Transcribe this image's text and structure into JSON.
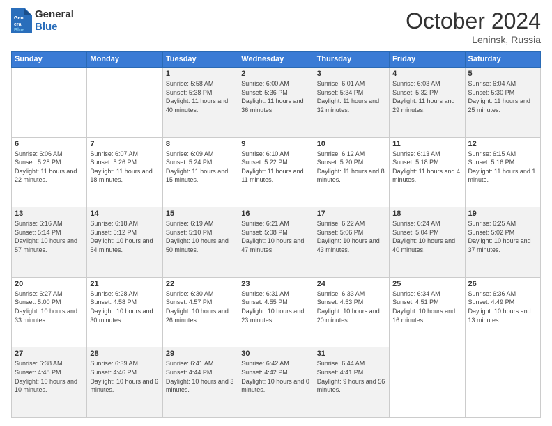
{
  "header": {
    "logo_general": "General",
    "logo_blue": "Blue",
    "month": "October 2024",
    "location": "Leninsk, Russia"
  },
  "days_of_week": [
    "Sunday",
    "Monday",
    "Tuesday",
    "Wednesday",
    "Thursday",
    "Friday",
    "Saturday"
  ],
  "weeks": [
    [
      {
        "day": "",
        "sunrise": "",
        "sunset": "",
        "daylight": "",
        "empty": true
      },
      {
        "day": "",
        "sunrise": "",
        "sunset": "",
        "daylight": "",
        "empty": true
      },
      {
        "day": "1",
        "sunrise": "Sunrise: 5:58 AM",
        "sunset": "Sunset: 5:38 PM",
        "daylight": "Daylight: 11 hours and 40 minutes.",
        "empty": false
      },
      {
        "day": "2",
        "sunrise": "Sunrise: 6:00 AM",
        "sunset": "Sunset: 5:36 PM",
        "daylight": "Daylight: 11 hours and 36 minutes.",
        "empty": false
      },
      {
        "day": "3",
        "sunrise": "Sunrise: 6:01 AM",
        "sunset": "Sunset: 5:34 PM",
        "daylight": "Daylight: 11 hours and 32 minutes.",
        "empty": false
      },
      {
        "day": "4",
        "sunrise": "Sunrise: 6:03 AM",
        "sunset": "Sunset: 5:32 PM",
        "daylight": "Daylight: 11 hours and 29 minutes.",
        "empty": false
      },
      {
        "day": "5",
        "sunrise": "Sunrise: 6:04 AM",
        "sunset": "Sunset: 5:30 PM",
        "daylight": "Daylight: 11 hours and 25 minutes.",
        "empty": false
      }
    ],
    [
      {
        "day": "6",
        "sunrise": "Sunrise: 6:06 AM",
        "sunset": "Sunset: 5:28 PM",
        "daylight": "Daylight: 11 hours and 22 minutes.",
        "empty": false
      },
      {
        "day": "7",
        "sunrise": "Sunrise: 6:07 AM",
        "sunset": "Sunset: 5:26 PM",
        "daylight": "Daylight: 11 hours and 18 minutes.",
        "empty": false
      },
      {
        "day": "8",
        "sunrise": "Sunrise: 6:09 AM",
        "sunset": "Sunset: 5:24 PM",
        "daylight": "Daylight: 11 hours and 15 minutes.",
        "empty": false
      },
      {
        "day": "9",
        "sunrise": "Sunrise: 6:10 AM",
        "sunset": "Sunset: 5:22 PM",
        "daylight": "Daylight: 11 hours and 11 minutes.",
        "empty": false
      },
      {
        "day": "10",
        "sunrise": "Sunrise: 6:12 AM",
        "sunset": "Sunset: 5:20 PM",
        "daylight": "Daylight: 11 hours and 8 minutes.",
        "empty": false
      },
      {
        "day": "11",
        "sunrise": "Sunrise: 6:13 AM",
        "sunset": "Sunset: 5:18 PM",
        "daylight": "Daylight: 11 hours and 4 minutes.",
        "empty": false
      },
      {
        "day": "12",
        "sunrise": "Sunrise: 6:15 AM",
        "sunset": "Sunset: 5:16 PM",
        "daylight": "Daylight: 11 hours and 1 minute.",
        "empty": false
      }
    ],
    [
      {
        "day": "13",
        "sunrise": "Sunrise: 6:16 AM",
        "sunset": "Sunset: 5:14 PM",
        "daylight": "Daylight: 10 hours and 57 minutes.",
        "empty": false
      },
      {
        "day": "14",
        "sunrise": "Sunrise: 6:18 AM",
        "sunset": "Sunset: 5:12 PM",
        "daylight": "Daylight: 10 hours and 54 minutes.",
        "empty": false
      },
      {
        "day": "15",
        "sunrise": "Sunrise: 6:19 AM",
        "sunset": "Sunset: 5:10 PM",
        "daylight": "Daylight: 10 hours and 50 minutes.",
        "empty": false
      },
      {
        "day": "16",
        "sunrise": "Sunrise: 6:21 AM",
        "sunset": "Sunset: 5:08 PM",
        "daylight": "Daylight: 10 hours and 47 minutes.",
        "empty": false
      },
      {
        "day": "17",
        "sunrise": "Sunrise: 6:22 AM",
        "sunset": "Sunset: 5:06 PM",
        "daylight": "Daylight: 10 hours and 43 minutes.",
        "empty": false
      },
      {
        "day": "18",
        "sunrise": "Sunrise: 6:24 AM",
        "sunset": "Sunset: 5:04 PM",
        "daylight": "Daylight: 10 hours and 40 minutes.",
        "empty": false
      },
      {
        "day": "19",
        "sunrise": "Sunrise: 6:25 AM",
        "sunset": "Sunset: 5:02 PM",
        "daylight": "Daylight: 10 hours and 37 minutes.",
        "empty": false
      }
    ],
    [
      {
        "day": "20",
        "sunrise": "Sunrise: 6:27 AM",
        "sunset": "Sunset: 5:00 PM",
        "daylight": "Daylight: 10 hours and 33 minutes.",
        "empty": false
      },
      {
        "day": "21",
        "sunrise": "Sunrise: 6:28 AM",
        "sunset": "Sunset: 4:58 PM",
        "daylight": "Daylight: 10 hours and 30 minutes.",
        "empty": false
      },
      {
        "day": "22",
        "sunrise": "Sunrise: 6:30 AM",
        "sunset": "Sunset: 4:57 PM",
        "daylight": "Daylight: 10 hours and 26 minutes.",
        "empty": false
      },
      {
        "day": "23",
        "sunrise": "Sunrise: 6:31 AM",
        "sunset": "Sunset: 4:55 PM",
        "daylight": "Daylight: 10 hours and 23 minutes.",
        "empty": false
      },
      {
        "day": "24",
        "sunrise": "Sunrise: 6:33 AM",
        "sunset": "Sunset: 4:53 PM",
        "daylight": "Daylight: 10 hours and 20 minutes.",
        "empty": false
      },
      {
        "day": "25",
        "sunrise": "Sunrise: 6:34 AM",
        "sunset": "Sunset: 4:51 PM",
        "daylight": "Daylight: 10 hours and 16 minutes.",
        "empty": false
      },
      {
        "day": "26",
        "sunrise": "Sunrise: 6:36 AM",
        "sunset": "Sunset: 4:49 PM",
        "daylight": "Daylight: 10 hours and 13 minutes.",
        "empty": false
      }
    ],
    [
      {
        "day": "27",
        "sunrise": "Sunrise: 6:38 AM",
        "sunset": "Sunset: 4:48 PM",
        "daylight": "Daylight: 10 hours and 10 minutes.",
        "empty": false
      },
      {
        "day": "28",
        "sunrise": "Sunrise: 6:39 AM",
        "sunset": "Sunset: 4:46 PM",
        "daylight": "Daylight: 10 hours and 6 minutes.",
        "empty": false
      },
      {
        "day": "29",
        "sunrise": "Sunrise: 6:41 AM",
        "sunset": "Sunset: 4:44 PM",
        "daylight": "Daylight: 10 hours and 3 minutes.",
        "empty": false
      },
      {
        "day": "30",
        "sunrise": "Sunrise: 6:42 AM",
        "sunset": "Sunset: 4:42 PM",
        "daylight": "Daylight: 10 hours and 0 minutes.",
        "empty": false
      },
      {
        "day": "31",
        "sunrise": "Sunrise: 6:44 AM",
        "sunset": "Sunset: 4:41 PM",
        "daylight": "Daylight: 9 hours and 56 minutes.",
        "empty": false
      },
      {
        "day": "",
        "sunrise": "",
        "sunset": "",
        "daylight": "",
        "empty": true
      },
      {
        "day": "",
        "sunrise": "",
        "sunset": "",
        "daylight": "",
        "empty": true
      }
    ]
  ]
}
